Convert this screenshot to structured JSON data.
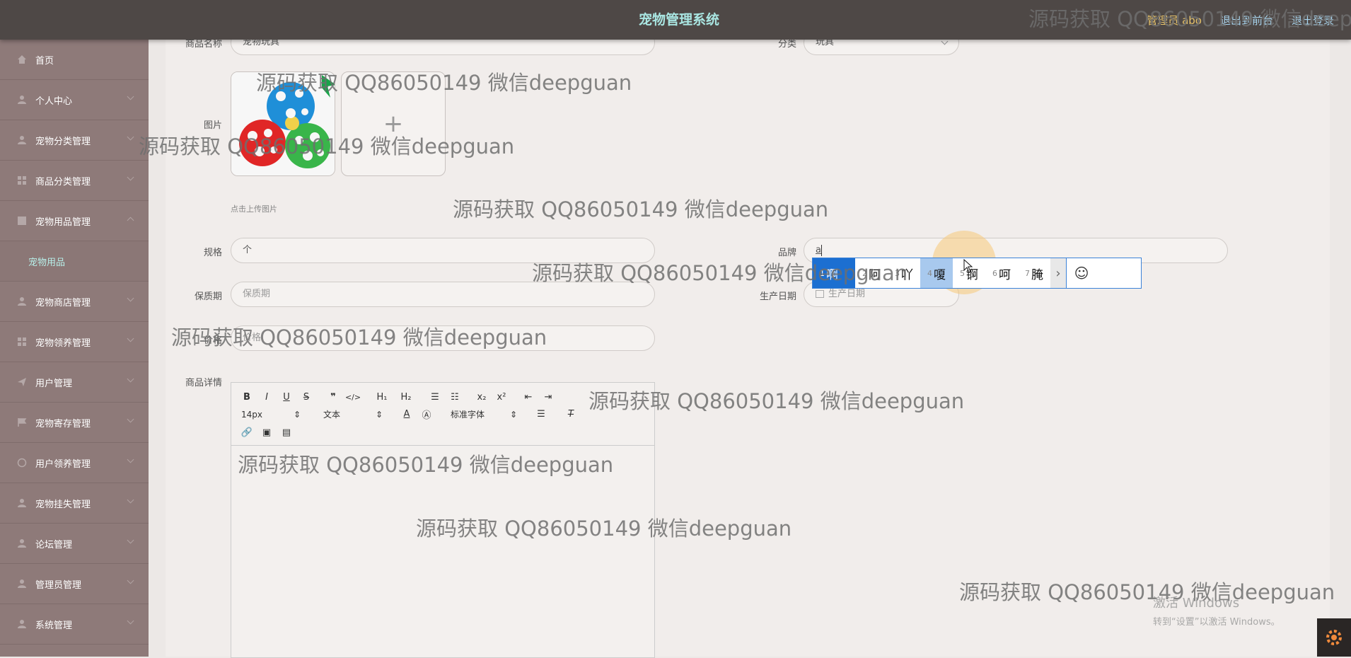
{
  "header": {
    "title": "宠物管理系统",
    "admin_label": "管理员 abo",
    "back_label": "退出到前台",
    "logout_label": "退出登录"
  },
  "sidebar": {
    "items": [
      {
        "label": "首页",
        "icon": "home-icon"
      },
      {
        "label": "个人中心",
        "icon": "user-icon"
      },
      {
        "label": "宠物分类管理",
        "icon": "user-icon"
      },
      {
        "label": "商品分类管理",
        "icon": "grid-icon"
      },
      {
        "label": "宠物用品管理",
        "icon": "grid-icon"
      },
      {
        "label": "宠物商店管理",
        "icon": "user-icon"
      },
      {
        "label": "宠物领养管理",
        "icon": "grid-icon"
      },
      {
        "label": "用户管理",
        "icon": "send-icon"
      },
      {
        "label": "宠物寄存管理",
        "icon": "flag-icon"
      },
      {
        "label": "用户领养管理",
        "icon": "circle-icon"
      },
      {
        "label": "宠物挂失管理",
        "icon": "user-icon"
      },
      {
        "label": "论坛管理",
        "icon": "user-icon"
      },
      {
        "label": "管理员管理",
        "icon": "user-icon"
      },
      {
        "label": "系统管理",
        "icon": "user-icon"
      }
    ],
    "sub_active": "宠物用品"
  },
  "form": {
    "name_label": "商品名称",
    "name_value": "宠物玩具",
    "category_label": "分类",
    "category_value": "玩具",
    "image_label": "图片",
    "upload_hint": "点击上传图片",
    "spec_label": "规格",
    "spec_value": "个",
    "brand_label": "品牌",
    "brand_value": "a",
    "shelf_life_label": "保质期",
    "shelf_life_placeholder": "保质期",
    "production_date_label": "生产日期",
    "production_date_placeholder": "生产日期",
    "price_label": "价格",
    "price_placeholder": "价格",
    "detail_label": "商品详情"
  },
  "editor": {
    "font_size": "14px",
    "text_style": "文本",
    "font_family": "标准字体"
  },
  "ime": {
    "candidates": [
      {
        "num": "1",
        "char": "啊"
      },
      {
        "num": "2",
        "char": "阿"
      },
      {
        "num": "3",
        "char": "吖"
      },
      {
        "num": "4",
        "char": "嗄"
      },
      {
        "num": "5",
        "char": "锕"
      },
      {
        "num": "6",
        "char": "呵"
      },
      {
        "num": "7",
        "char": "腌"
      }
    ]
  },
  "watermark": {
    "text": "源码获取 QQ86050149 微信deepguan",
    "header_text": "源码获取 QQ86050149 微信deep"
  },
  "windows_activation": {
    "line1": "激活 Windows",
    "line2": "转到“设置”以激活 Windows。"
  }
}
